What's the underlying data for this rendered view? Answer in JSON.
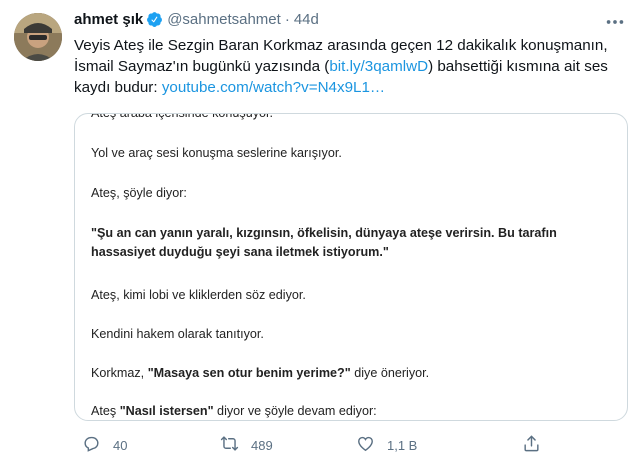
{
  "author": {
    "name": "ahmet şık",
    "handle": "@sahmetsahmet",
    "separator": "·",
    "time": "44d"
  },
  "tweet": {
    "text_part1": "Veyis Ateş ile Sezgin Baran Korkmaz arasında geçen 12 dakikalık konuşmanın, İsmail Saymaz'ın bugünkü yazısında (",
    "link1": "bit.ly/3qamlwD",
    "text_part2": ") bahsettiği  kısmına ait ses kaydı budur: ",
    "link2": "youtube.com/watch?v=N4x9L1…"
  },
  "document": {
    "line_cut": "Ateş araba içerisinde konuşuyor.",
    "line1": "Yol ve araç sesi konuşma seslerine karışıyor.",
    "line2": "Ateş, şöyle diyor:",
    "quote_line1": "\"Şu an can yanın yaralı, kızgınsın, öfkelisin, dünyaya ateşe verirsin. Bu tarafın",
    "quote_line2": "hassasiyet duyduğu şeyi sana iletmek istiyorum.\"",
    "line3": "Ateş, kimi lobi ve kliklerden söz ediyor.",
    "line4": "Kendini hakem olarak tanıtıyor.",
    "line5_pre": "Korkmaz, ",
    "line5_bold": "\"Masaya sen otur benim yerime?\"",
    "line5_post": " diye öneriyor.",
    "line6_pre": "Ateş ",
    "line6_bold": "\"Nasıl istersen\"",
    "line6_post": " diyor ve şöyle devam ediyor:"
  },
  "actions": {
    "reply_count": "40",
    "retweet_count": "489",
    "like_count": "1,1 B"
  },
  "icons": {
    "verified": "verified-badge-icon",
    "more": "more-icon",
    "reply": "reply-icon",
    "retweet": "retweet-icon",
    "like": "like-icon",
    "share": "share-icon"
  },
  "colors": {
    "link": "#1b95e0",
    "verified": "#1da1f2",
    "muted": "#5b7083"
  }
}
